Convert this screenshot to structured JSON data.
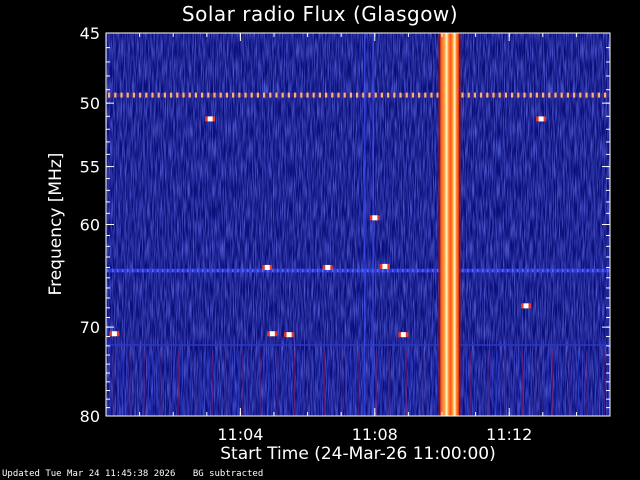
{
  "colors": {
    "background": "#000000",
    "axis": "#ffffff",
    "low": "#0a0f7a",
    "mid": "#2730d8",
    "high": "#ff3a1a",
    "peak": "#ffffff"
  },
  "footer": {
    "updated": "Updated Tue Mar 24 11:45:38 2026",
    "note": "BG subtracted"
  },
  "chart_data": {
    "type": "heatmap",
    "title": "Solar radio Flux (Glasgow)",
    "xlabel": "Start Time (24-Mar-26 11:00:00)",
    "ylabel": "Frequency [MHz]",
    "x_unit": "minutes after 11:00:00",
    "xlim": [
      0.0,
      15.0
    ],
    "ylim": [
      45,
      80
    ],
    "y_scale": "log",
    "y_inverted": true,
    "x_ticks": [
      {
        "value": 4,
        "label": "11:04"
      },
      {
        "value": 8,
        "label": "11:08"
      },
      {
        "value": 12,
        "label": "11:12"
      }
    ],
    "y_ticks": [
      {
        "value": 45,
        "label": "45"
      },
      {
        "value": 50,
        "label": "50"
      },
      {
        "value": 55,
        "label": "55"
      },
      {
        "value": 60,
        "label": "60"
      },
      {
        "value": 70,
        "label": "70"
      },
      {
        "value": 80,
        "label": "80"
      }
    ],
    "bursts": [
      {
        "name": "type III burst",
        "t_start": 9.95,
        "t_end": 10.5,
        "f_min": 45,
        "f_max": 80,
        "intensity": "high"
      }
    ],
    "interference_bands": [
      {
        "freq": 49.4,
        "intensity": "high"
      },
      {
        "freq": 64.3,
        "intensity": "medium"
      },
      {
        "freq": 71.9,
        "intensity": "low"
      }
    ],
    "hot_spots": [
      {
        "time": 3.1,
        "freq": 51.2
      },
      {
        "time": 12.95,
        "freq": 51.2
      },
      {
        "time": 0.25,
        "freq": 70.7
      },
      {
        "time": 4.95,
        "freq": 70.7
      },
      {
        "time": 5.45,
        "freq": 70.8
      },
      {
        "time": 8.85,
        "freq": 70.8
      },
      {
        "time": 4.8,
        "freq": 64.0
      },
      {
        "time": 6.6,
        "freq": 64.0
      },
      {
        "time": 8.3,
        "freq": 63.9
      },
      {
        "time": 12.5,
        "freq": 67.8
      },
      {
        "time": 8.0,
        "freq": 59.4
      }
    ]
  }
}
